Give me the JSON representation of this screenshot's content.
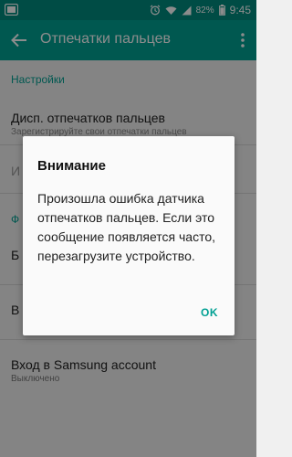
{
  "status_bar": {
    "battery": "82%",
    "time": "9:45"
  },
  "app_bar": {
    "title": "Отпечатки пальцев"
  },
  "settings": {
    "section1_header": "Настройки",
    "item1_title": "Дисп. отпечатков пальцев",
    "item1_sub": "Зарегистрируйте свои отпечатки пальцев",
    "item2_title_partial": "И",
    "section2_header_partial": "Ф",
    "item3_title_partial": "Б",
    "item4_title_partial": "В",
    "item5_title": "Вход в Samsung account",
    "item5_sub": "Выключено"
  },
  "dialog": {
    "title": "Внимание",
    "message": "Произошла ошибка датчика отпечатков пальцев. Если это сообщение появляется часто, перезагрузите устройство.",
    "ok_label": "OK"
  },
  "colors": {
    "status_bar": "#008a7e",
    "app_bar": "#00a093",
    "accent": "#00a093"
  }
}
